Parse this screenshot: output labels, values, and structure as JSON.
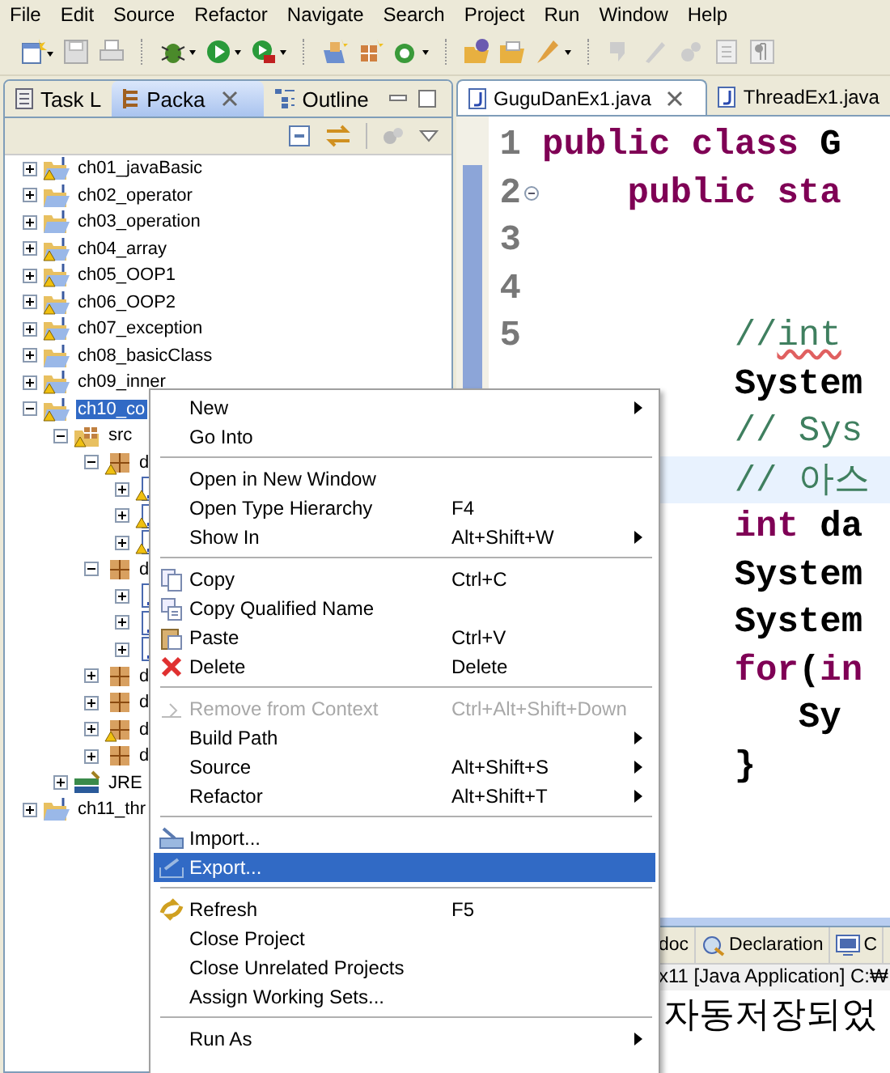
{
  "menubar": [
    "File",
    "Edit",
    "Source",
    "Refactor",
    "Navigate",
    "Search",
    "Project",
    "Run",
    "Window",
    "Help"
  ],
  "left_panel": {
    "tabs": [
      {
        "label": "Task L",
        "kind": "tasks",
        "selected": false
      },
      {
        "label": "Packa",
        "kind": "packages",
        "selected": true
      },
      {
        "label": "Outline",
        "kind": "outline",
        "selected": false
      }
    ],
    "tree": [
      {
        "label": "ch01_javaBasic",
        "kind": "project",
        "warning": true,
        "expanded": false,
        "selected": false
      },
      {
        "label": "ch02_operator",
        "kind": "project",
        "warning": false,
        "expanded": false,
        "selected": false
      },
      {
        "label": "ch03_operation",
        "kind": "project",
        "warning": false,
        "expanded": false,
        "selected": false
      },
      {
        "label": "ch04_array",
        "kind": "project",
        "warning": true,
        "expanded": false,
        "selected": false
      },
      {
        "label": "ch05_OOP1",
        "kind": "project",
        "warning": true,
        "expanded": false,
        "selected": false
      },
      {
        "label": "ch06_OOP2",
        "kind": "project",
        "warning": true,
        "expanded": false,
        "selected": false
      },
      {
        "label": "ch07_exception",
        "kind": "project",
        "warning": true,
        "expanded": false,
        "selected": false
      },
      {
        "label": "ch08_basicClass",
        "kind": "project",
        "warning": false,
        "expanded": false,
        "selected": false
      },
      {
        "label": "ch09_inner",
        "kind": "project",
        "warning": true,
        "expanded": false,
        "selected": false
      },
      {
        "label": "ch10_co",
        "kind": "project",
        "warning": true,
        "expanded": true,
        "selected": true,
        "children": [
          {
            "label": "src",
            "kind": "source_folder",
            "warning": true,
            "expanded": true,
            "selected": false,
            "children": [
              {
                "label": "d",
                "kind": "package",
                "warning": true,
                "expanded": true,
                "selected": false,
                "children": [
                  {
                    "kind": "file",
                    "warning": true,
                    "expanded": false,
                    "selected": false
                  },
                  {
                    "kind": "file",
                    "warning": true,
                    "expanded": false,
                    "selected": false
                  },
                  {
                    "kind": "file",
                    "warning": true,
                    "expanded": false,
                    "selected": false
                  }
                ]
              },
              {
                "label": "d",
                "kind": "package",
                "warning": false,
                "expanded": true,
                "selected": false,
                "children": [
                  {
                    "kind": "file",
                    "warning": false,
                    "expanded": false,
                    "selected": false
                  },
                  {
                    "kind": "file",
                    "warning": false,
                    "expanded": false,
                    "selected": false
                  },
                  {
                    "kind": "file",
                    "warning": false,
                    "expanded": false,
                    "selected": false
                  }
                ]
              },
              {
                "label": "d",
                "kind": "package",
                "warning": false,
                "expanded": false,
                "selected": false
              },
              {
                "label": "d",
                "kind": "package",
                "warning": false,
                "expanded": false,
                "selected": false
              },
              {
                "label": "d",
                "kind": "package",
                "warning": true,
                "expanded": false,
                "selected": false
              },
              {
                "label": "d",
                "kind": "package",
                "warning": false,
                "expanded": false,
                "selected": false
              }
            ]
          },
          {
            "label": "JRE",
            "kind": "library",
            "warning": false,
            "expanded": false,
            "selected": false
          }
        ]
      },
      {
        "label": "ch11_thr",
        "kind": "project",
        "warning": false,
        "expanded": false,
        "selected": false
      }
    ]
  },
  "editor": {
    "tabs": [
      {
        "label": "GuguDanEx1.java",
        "selected": true
      },
      {
        "label": "ThreadEx1.java",
        "selected": false
      }
    ],
    "lines": [
      {
        "number": "1",
        "tokens": [
          {
            "text": "public class ",
            "kind": "keyword"
          },
          {
            "text": "G",
            "kind": "plain"
          }
        ]
      },
      {
        "number": "2",
        "fold": true,
        "tokens": [
          {
            "text": "    public sta",
            "kind": "keyword"
          }
        ]
      },
      {
        "number": "3"
      },
      {
        "number": "4"
      },
      {
        "number": "5",
        "tokens": [
          {
            "text": "         //",
            "kind": "comment"
          },
          {
            "text": "int",
            "kind": "comment",
            "squiggle": true
          }
        ]
      },
      {
        "tokens": [
          {
            "text": "         System",
            "kind": "plain"
          }
        ]
      },
      {
        "tokens": [
          {
            "text": "         // Sys",
            "kind": "comment"
          }
        ]
      },
      {
        "current": true,
        "tokens": [
          {
            "text": "         // 아스",
            "kind": "comment"
          }
        ]
      },
      {
        "tokens": [
          {
            "text": "         int",
            "kind": "keyword"
          },
          {
            "text": " da",
            "kind": "plain"
          }
        ]
      },
      {
        "tokens": [
          {
            "text": "         System",
            "kind": "plain"
          }
        ]
      },
      {
        "tokens": [
          {
            "text": "         System",
            "kind": "plain"
          }
        ]
      },
      {
        "tokens": [
          {
            "text": "         for",
            "kind": "keyword"
          },
          {
            "text": "(",
            "kind": "plain"
          },
          {
            "text": "in",
            "kind": "keyword"
          }
        ]
      },
      {
        "tokens": [
          {
            "text": "            Sy",
            "kind": "plain"
          }
        ]
      },
      {
        "tokens": [
          {
            "text": "         }",
            "kind": "plain"
          }
        ]
      }
    ]
  },
  "bottom_panel": {
    "tabs": [
      {
        "label": "doc",
        "kind": "javadoc"
      },
      {
        "label": "Declaration",
        "kind": "declaration"
      },
      {
        "label": "C",
        "kind": "console"
      }
    ],
    "console_header": "x11 [Java Application] C:₩",
    "output": "자동저장되었"
  },
  "context_menu": [
    {
      "kind": "item",
      "label": "New",
      "submenu": true
    },
    {
      "kind": "item",
      "label": "Go Into"
    },
    {
      "kind": "separator"
    },
    {
      "kind": "item",
      "label": "Open in New Window"
    },
    {
      "kind": "item",
      "label": "Open Type Hierarchy",
      "shortcut": "F4"
    },
    {
      "kind": "item",
      "label": "Show In",
      "shortcut": "Alt+Shift+W",
      "submenu": true
    },
    {
      "kind": "separator"
    },
    {
      "kind": "item",
      "label": "Copy",
      "shortcut": "Ctrl+C"
    },
    {
      "kind": "item",
      "label": "Copy Qualified Name"
    },
    {
      "kind": "item",
      "label": "Paste",
      "shortcut": "Ctrl+V"
    },
    {
      "kind": "item",
      "label": "Delete",
      "shortcut": "Delete"
    },
    {
      "kind": "separator"
    },
    {
      "kind": "item",
      "label": "Remove from Context",
      "shortcut": "Ctrl+Alt+Shift+Down",
      "disabled": true
    },
    {
      "kind": "item",
      "label": "Build Path",
      "submenu": true
    },
    {
      "kind": "item",
      "label": "Source",
      "shortcut": "Alt+Shift+S",
      "submenu": true
    },
    {
      "kind": "item",
      "label": "Refactor",
      "shortcut": "Alt+Shift+T",
      "submenu": true
    },
    {
      "kind": "separator"
    },
    {
      "kind": "item",
      "label": "Import..."
    },
    {
      "kind": "item",
      "label": "Export...",
      "selected": true
    },
    {
      "kind": "separator"
    },
    {
      "kind": "item",
      "label": "Refresh",
      "shortcut": "F5"
    },
    {
      "kind": "item",
      "label": "Close Project"
    },
    {
      "kind": "item",
      "label": "Close Unrelated Projects"
    },
    {
      "kind": "item",
      "label": "Assign Working Sets..."
    },
    {
      "kind": "separator"
    },
    {
      "kind": "item",
      "label": "Run As",
      "submenu": true
    }
  ]
}
